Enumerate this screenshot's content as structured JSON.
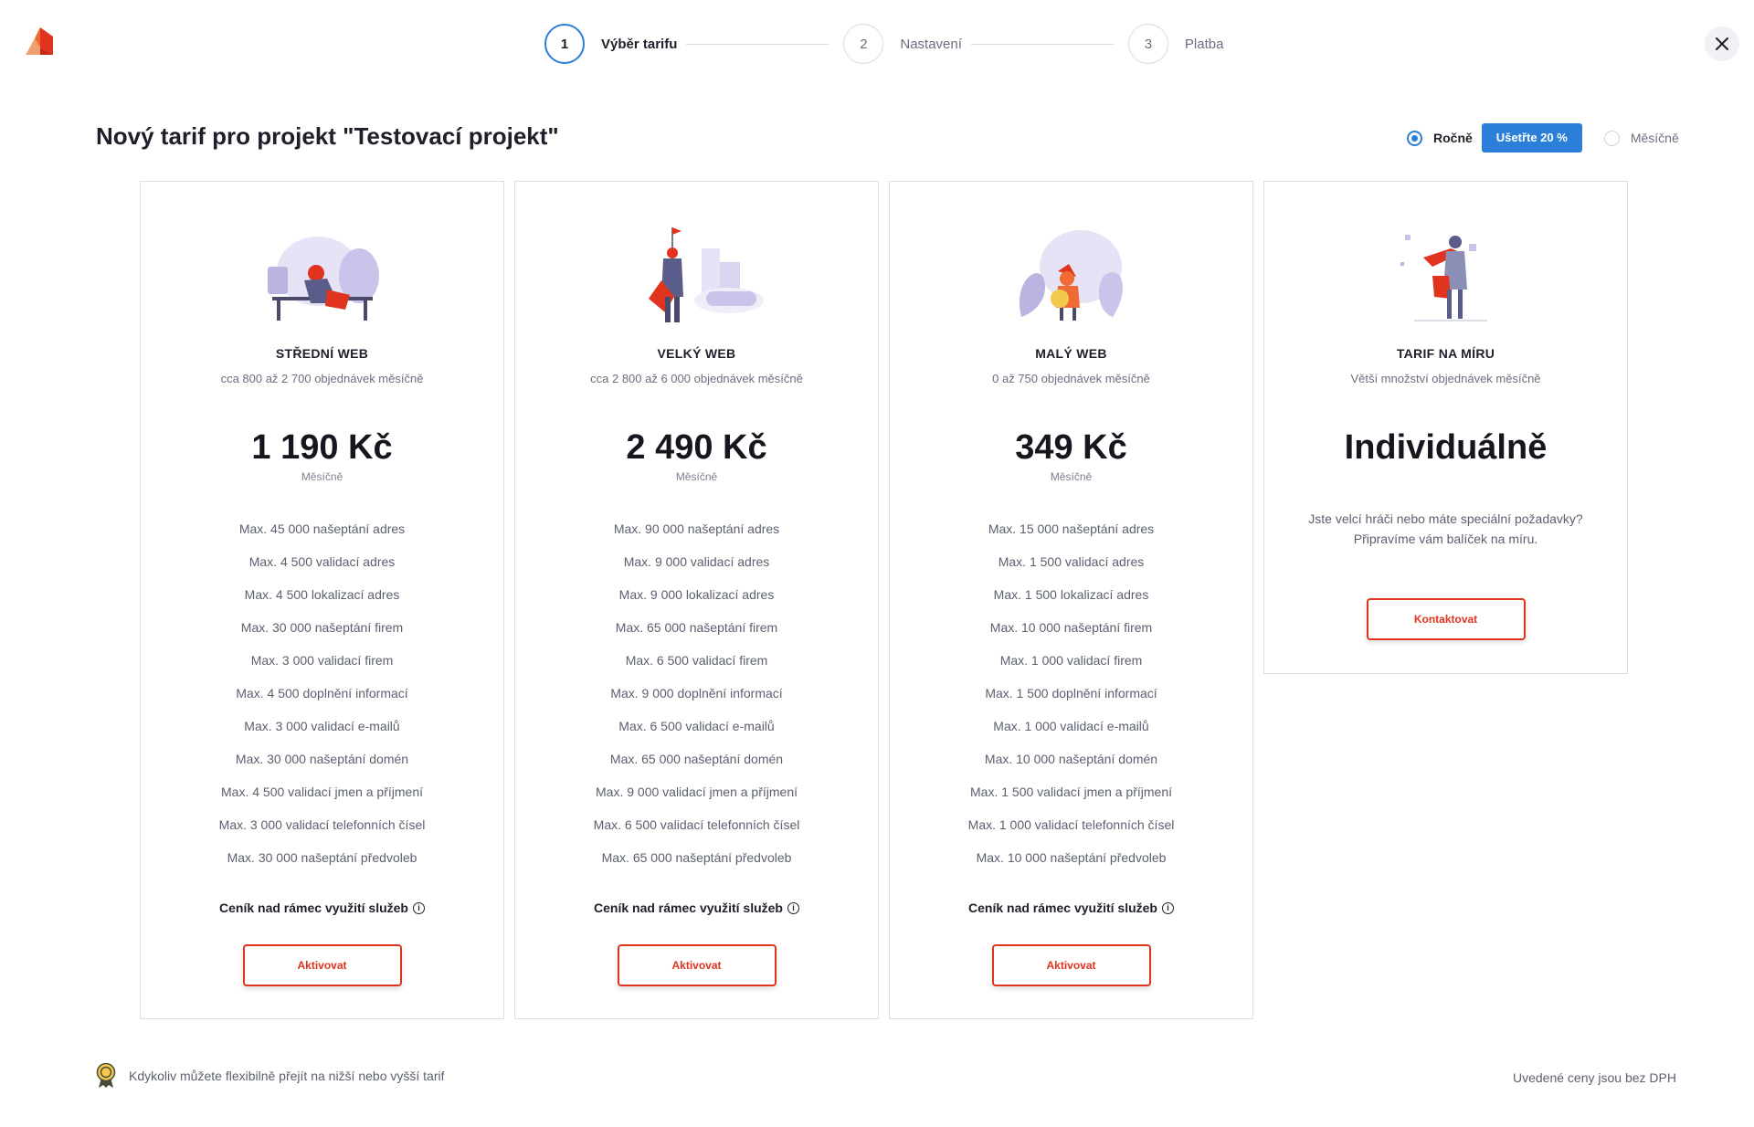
{
  "stepper": {
    "steps": [
      {
        "number": "1",
        "label": "Výběr tarifu",
        "state": "active"
      },
      {
        "number": "2",
        "label": "Nastavení",
        "state": "inactive"
      },
      {
        "number": "3",
        "label": "Platba",
        "state": "inactive"
      }
    ]
  },
  "page": {
    "title": "Nový tarif pro projekt \"Testovací projekt\""
  },
  "billing": {
    "yearly_label": "Ročně",
    "save_badge": "Ušetřte 20 %",
    "monthly_label": "Měsíčně",
    "selected": "yearly"
  },
  "plans": [
    {
      "name": "STŘEDNÍ WEB",
      "subtitle": "cca 800 až 2 700 objednávek měsíčně",
      "price": "1 190 Kč",
      "period": "Měsíčně",
      "features": [
        "Max. 45 000 našeptání adres",
        "Max. 4 500 validací adres",
        "Max. 4 500 lokalizací adres",
        "Max. 30 000 našeptání firem",
        "Max. 3 000 validací firem",
        "Max. 4 500 doplnění informací",
        "Max. 3 000 validací e-mailů",
        "Max. 30 000 našeptání domén",
        "Max. 4 500 validací jmen a příjmení",
        "Max. 3 000 validací telefonních čísel",
        "Max. 30 000 našeptání předvoleb"
      ],
      "overprice_label": "Ceník nad rámec využití služeb",
      "button": "Aktivovat"
    },
    {
      "name": "VELKÝ WEB",
      "subtitle": "cca 2 800 až 6 000 objednávek měsíčně",
      "price": "2 490 Kč",
      "period": "Měsíčně",
      "features": [
        "Max. 90 000 našeptání adres",
        "Max. 9 000 validací adres",
        "Max. 9 000 lokalizací adres",
        "Max. 65 000 našeptání firem",
        "Max. 6 500 validací firem",
        "Max. 9 000 doplnění informací",
        "Max. 6 500 validací e-mailů",
        "Max. 65 000 našeptání domén",
        "Max. 9 000 validací jmen a příjmení",
        "Max. 6 500 validací telefonních čísel",
        "Max. 65 000 našeptání předvoleb"
      ],
      "overprice_label": "Ceník nad rámec využití služeb",
      "button": "Aktivovat"
    },
    {
      "name": "MALÝ WEB",
      "subtitle": "0 až 750 objednávek měsíčně",
      "price": "349 Kč",
      "period": "Měsíčně",
      "features": [
        "Max. 15 000 našeptání adres",
        "Max. 1 500 validací adres",
        "Max. 1 500 lokalizací adres",
        "Max. 10 000 našeptání firem",
        "Max. 1 000 validací firem",
        "Max. 1 500 doplnění informací",
        "Max. 1 000 validací e-mailů",
        "Max. 10 000 našeptání domén",
        "Max. 1 500 validací jmen a příjmení",
        "Max. 1 000 validací telefonních čísel",
        "Max. 10 000 našeptání předvoleb"
      ],
      "overprice_label": "Ceník nad rámec využití služeb",
      "button": "Aktivovat"
    },
    {
      "name": "TARIF NA MÍRU",
      "subtitle": "Větší množství objednávek měsíčně",
      "price": "Individuálně",
      "description_line1": "Jste velcí hráči nebo máte speciální požadavky?",
      "description_line2": "Připravíme vám balíček na míru.",
      "button": "Kontaktovat"
    }
  ],
  "footer": {
    "left_text": "Kdykoliv můžete flexibilně přejít na nižší nebo vyšší tarif",
    "right_text": "Uvedené ceny jsou bez DPH"
  },
  "colors": {
    "accent_blue": "#2b7fd8",
    "accent_red": "#e0341f",
    "illustration_purple": "#b9b4e0"
  }
}
